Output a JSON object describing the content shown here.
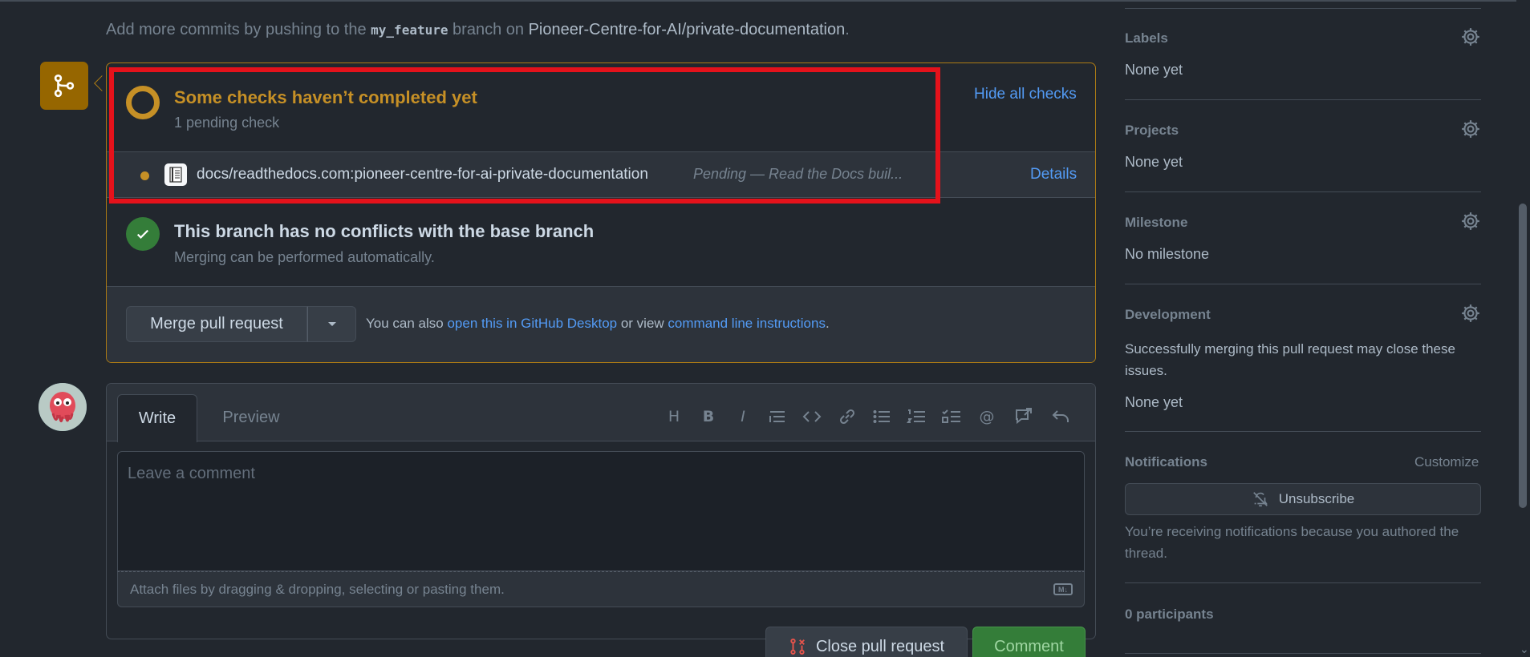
{
  "push_info": {
    "prefix": "Add more commits by pushing to the ",
    "branch": "my_feature",
    "middle": " branch on ",
    "repo": "Pioneer-Centre-for-AI/private-documentation",
    "suffix": "."
  },
  "checks": {
    "title": "Some checks haven’t completed yet",
    "subtitle": "1 pending check",
    "hide_label": "Hide all checks",
    "items": [
      {
        "name": "docs/readthedocs.com:pioneer-centre-for-ai-private-documentation",
        "description": "Pending — Read the Docs buil...",
        "details_label": "Details",
        "status_color": "#c69026"
      }
    ]
  },
  "conflicts": {
    "title": "This branch has no conflicts with the base branch",
    "subtitle": "Merging can be performed automatically."
  },
  "merge": {
    "button_label": "Merge pull request",
    "alt_prefix": "You can also ",
    "desktop_link": "open this in GitHub Desktop",
    "alt_middle": " or view ",
    "cli_link": "command line instructions",
    "alt_suffix": "."
  },
  "comment": {
    "tab_write": "Write",
    "tab_preview": "Preview",
    "placeholder": "Leave a comment",
    "attach_hint": "Attach files by dragging & dropping, selecting or pasting them.",
    "markdown_badge": "M↓",
    "close_label": "Close pull request",
    "comment_label": "Comment",
    "toolbar_icons": [
      "heading-icon",
      "bold-icon",
      "italic-icon",
      "quote-icon",
      "code-icon",
      "link-icon",
      "unordered-list-icon",
      "ordered-list-icon",
      "task-list-icon",
      "mention-icon",
      "reference-icon",
      "undo-icon"
    ]
  },
  "sidebar": {
    "labels": {
      "title": "Labels",
      "value": "None yet"
    },
    "projects": {
      "title": "Projects",
      "value": "None yet"
    },
    "milestone": {
      "title": "Milestone",
      "value": "No milestone"
    },
    "development": {
      "title": "Development",
      "description": "Successfully merging this pull request may close these issues.",
      "value": "None yet"
    },
    "notifications": {
      "title": "Notifications",
      "customize": "Customize",
      "unsubscribe": "Unsubscribe",
      "note": "You’re receiving notifications because you authored the thread."
    },
    "participants": "0 participants"
  },
  "colors": {
    "pending": "#c69026",
    "success": "#347d39",
    "link": "#539bf5",
    "highlight": "#e5121b"
  }
}
